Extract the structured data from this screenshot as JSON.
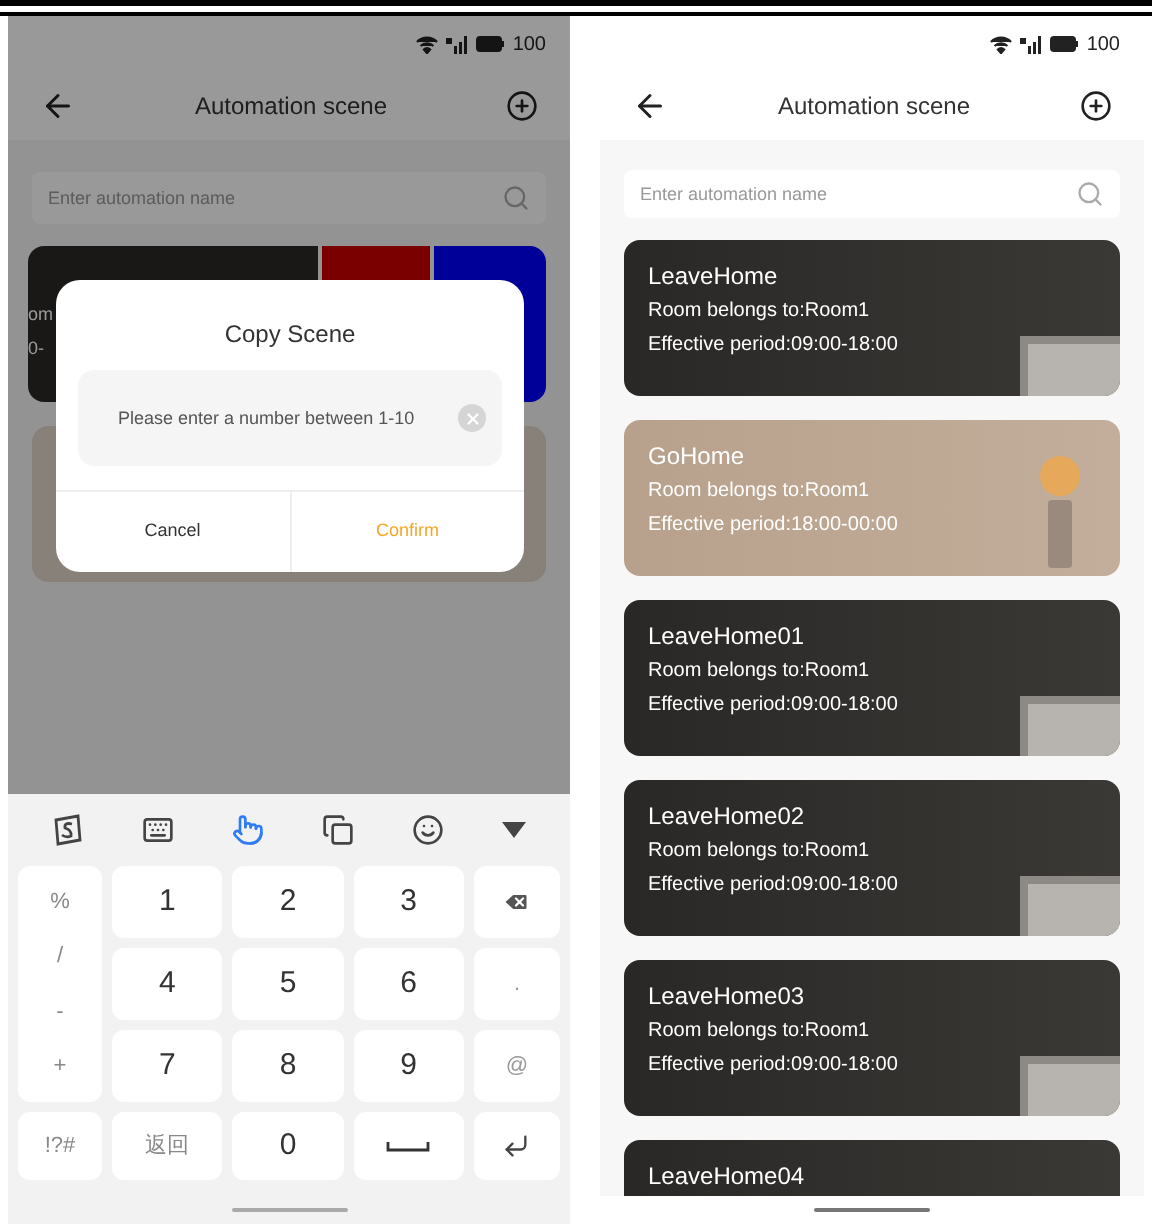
{
  "left_screen": {
    "status_bar": {
      "battery": "100"
    },
    "header": {
      "title": "Automation scene"
    },
    "search": {
      "placeholder": "Enter automation name"
    },
    "swiped_card": {
      "line_1": "om",
      "line_2": "0-"
    },
    "dialog": {
      "title": "Copy Scene",
      "input": {
        "placeholder": "Please enter a number between 1-10"
      },
      "buttons": [
        {
          "label": "Cancel",
          "kind": "cancel"
        },
        {
          "label": "Confirm",
          "kind": "confirm"
        }
      ]
    },
    "keyboard": {
      "toolbar": [
        {
          "kind": "logo",
          "selected": false
        },
        {
          "kind": "keyboard",
          "selected": false
        },
        {
          "kind": "hand",
          "selected": true
        },
        {
          "kind": "clipboard",
          "selected": false
        },
        {
          "kind": "emoji",
          "selected": false
        },
        {
          "kind": "collapse",
          "selected": false
        }
      ],
      "symbol_key": [
        "%",
        "/",
        "-",
        "+"
      ],
      "number_rows": [
        [
          "1",
          "2",
          "3"
        ],
        [
          "4",
          "5",
          "6"
        ],
        [
          "7",
          "8",
          "9"
        ]
      ],
      "side_keys": [
        {
          "kind": "backspace"
        },
        {
          "kind": "text",
          "label": "."
        },
        {
          "kind": "text",
          "label": "@"
        }
      ],
      "bottom_row": [
        {
          "kind": "text",
          "label": "!?#"
        },
        {
          "kind": "text",
          "label": "返回"
        },
        {
          "kind": "text",
          "label": "0"
        },
        {
          "kind": "space"
        },
        {
          "kind": "enter"
        }
      ]
    }
  },
  "right_screen": {
    "status_bar": {
      "battery": "100"
    },
    "header": {
      "title": "Automation scene"
    },
    "search": {
      "placeholder": "Enter automation name"
    },
    "scenes": [
      {
        "name": "LeaveHome",
        "room": "Room belongs to:Room1",
        "period": "Effective period:09:00-18:00",
        "kind": "dark"
      },
      {
        "name": "GoHome",
        "room": "Room belongs to:Room1",
        "period": "Effective period:18:00-00:00",
        "kind": "light"
      },
      {
        "name": "LeaveHome01",
        "room": "Room belongs to:Room1",
        "period": "Effective period:09:00-18:00",
        "kind": "dark"
      },
      {
        "name": "LeaveHome02",
        "room": "Room belongs to:Room1",
        "period": "Effective period:09:00-18:00",
        "kind": "dark"
      },
      {
        "name": "LeaveHome03",
        "room": "Room belongs to:Room1",
        "period": "Effective period:09:00-18:00",
        "kind": "dark"
      },
      {
        "name": "LeaveHome04",
        "kind": "dark"
      }
    ]
  }
}
